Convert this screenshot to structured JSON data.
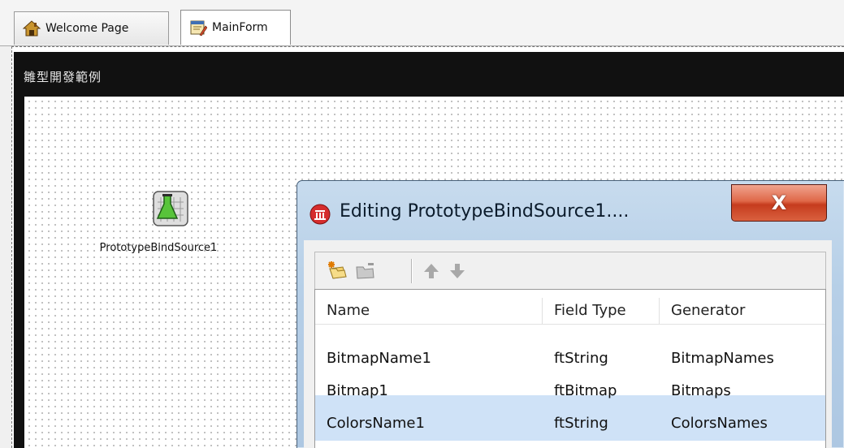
{
  "tabs": [
    {
      "label": "Welcome Page",
      "icon": "home-icon",
      "active": false
    },
    {
      "label": "MainForm",
      "icon": "form-icon",
      "active": true
    }
  ],
  "form": {
    "title": "雛型開發範例",
    "component_label": "PrototypeBindSource1",
    "component_icon": "flask-grid-icon"
  },
  "dialog": {
    "title": "Editing PrototypeBindSource1....",
    "close_label": "X",
    "toolbar": {
      "new_icon": "new-field-icon",
      "delete_icon": "delete-field-icon",
      "up_icon": "arrow-up-icon",
      "down_icon": "arrow-down-icon"
    },
    "columns": [
      "Name",
      "Field Type",
      "Generator"
    ],
    "rows": [
      {
        "name": "BitmapName1",
        "field_type": "ftString",
        "generator": "BitmapNames"
      },
      {
        "name": "Bitmap1",
        "field_type": "ftBitmap",
        "generator": "Bitmaps"
      },
      {
        "name": "ColorsName1",
        "field_type": "ftString",
        "generator": "ColorsNames"
      }
    ]
  },
  "colors": {
    "form_caption_bg": "#111111",
    "dialog_frame": "#b6cfe7",
    "close_button": "#d9603f",
    "selection_row": "#cfe2f7"
  }
}
